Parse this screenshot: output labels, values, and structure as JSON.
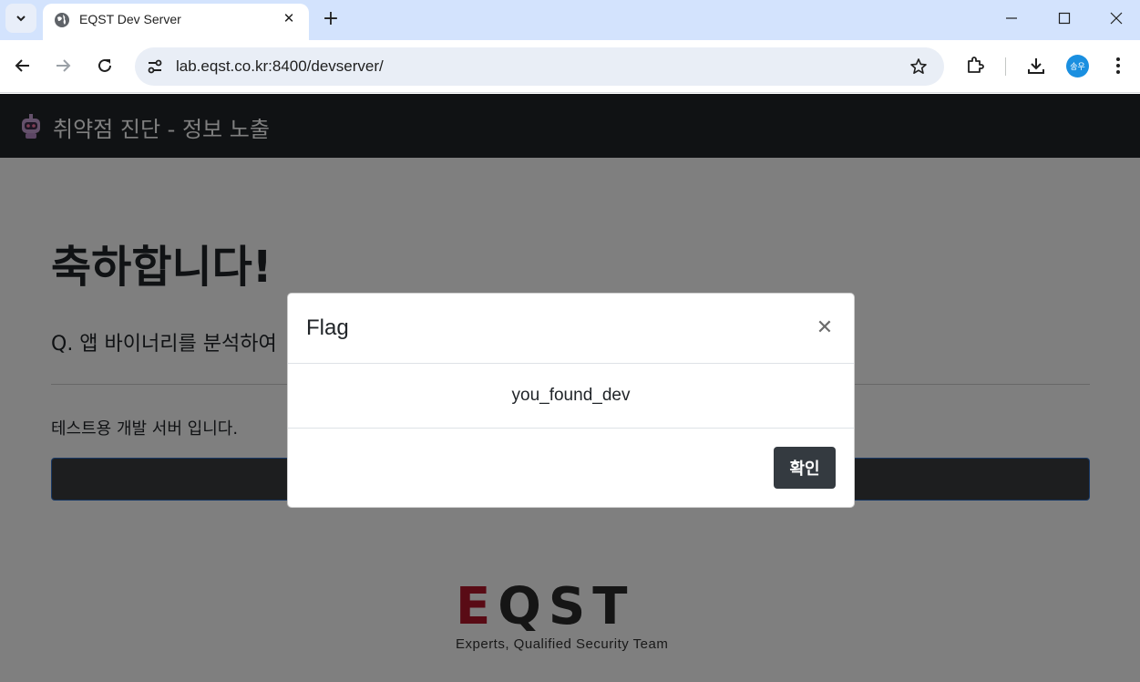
{
  "browser": {
    "tab": {
      "title": "EQST Dev Server"
    },
    "address_bar": {
      "url": "lab.eqst.co.kr:8400/devserver/"
    },
    "profile": {
      "initials": "송우"
    }
  },
  "site": {
    "header_title": "취약점 진단 - 정보 노출",
    "heading": "축하합니다!",
    "question": "Q. 앱 바이너리를 분석하여",
    "description": "테스트용 개발 서버 입니다.",
    "brand_name": "EQST",
    "brand_tagline": "Experts, Qualified Security Team"
  },
  "modal": {
    "title": "Flag",
    "body": "you_found_dev",
    "confirm_label": "확인"
  },
  "colors": {
    "header_bg": "#212529",
    "brand_red": "#b3172b",
    "button_bg": "#343a40",
    "tabstrip_bg": "#d3e3fd"
  }
}
